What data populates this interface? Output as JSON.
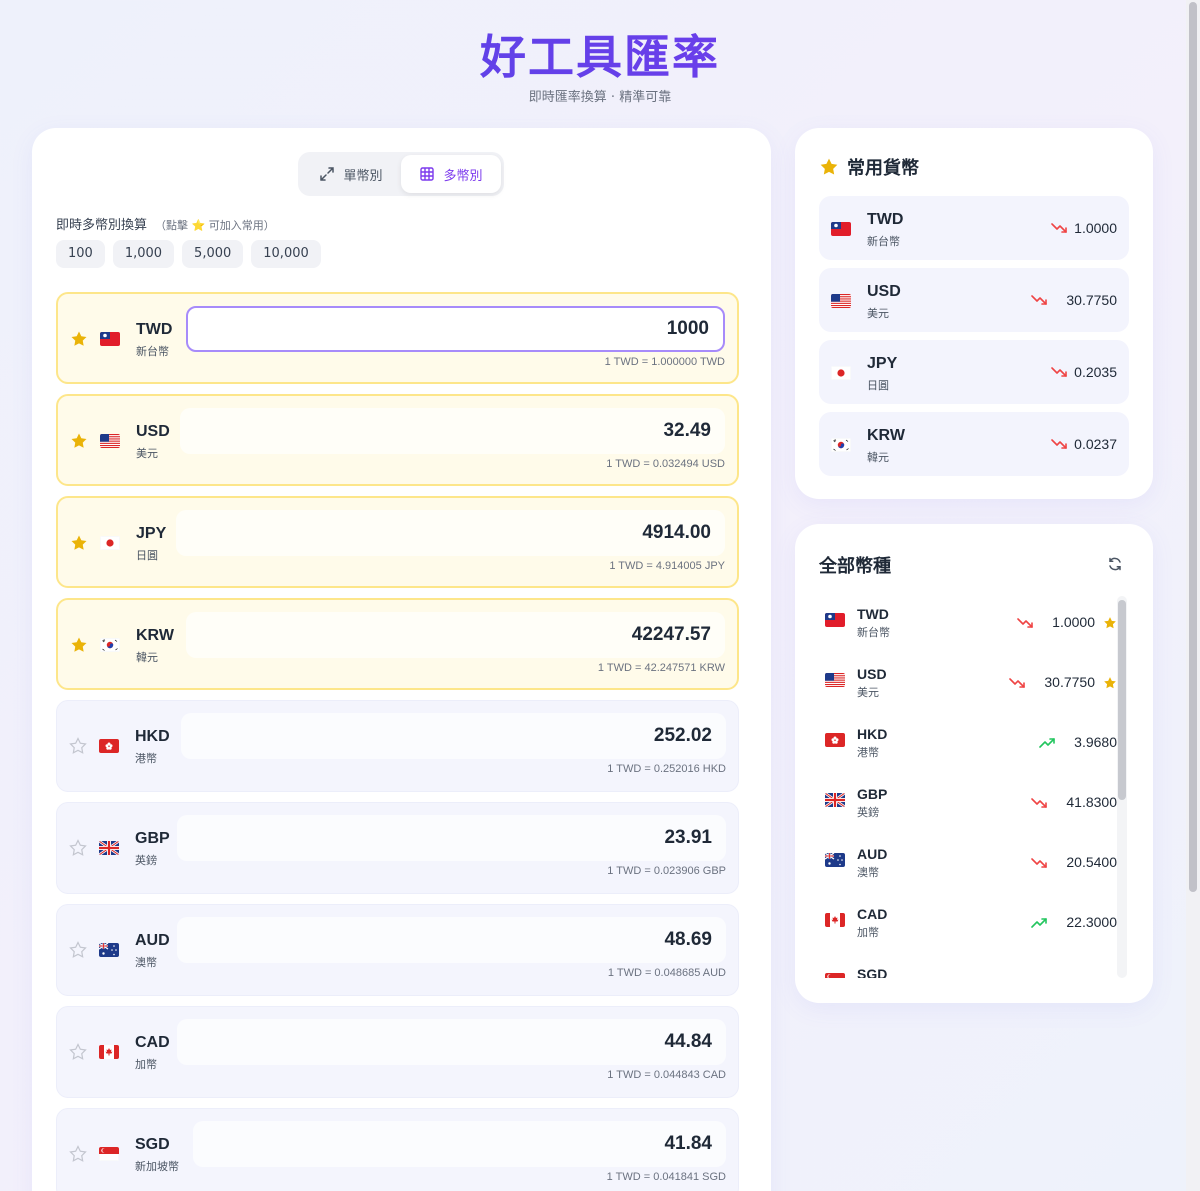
{
  "header": {
    "title": "好工具匯率",
    "subtitle": "即時匯率換算 · 精準可靠"
  },
  "mode": {
    "single_label": "單幣別",
    "multi_label": "多幣別",
    "active": "multi"
  },
  "converter": {
    "hint": "即時多幣別換算",
    "hint_small": "（點擊 ⭐ 可加入常用）",
    "quick_amounts": [
      "100",
      "1,000",
      "5,000",
      "10,000"
    ],
    "rows": [
      {
        "code": "TWD",
        "name": "新台幣",
        "flag": "tw",
        "favorite": true,
        "base": true,
        "amount": "1000",
        "rate_line": "1 TWD = 1.000000 TWD"
      },
      {
        "code": "USD",
        "name": "美元",
        "flag": "us",
        "favorite": true,
        "base": false,
        "amount": "32.49",
        "rate_line": "1 TWD = 0.032494 USD"
      },
      {
        "code": "JPY",
        "name": "日圓",
        "flag": "jp",
        "favorite": true,
        "base": false,
        "amount": "4914.00",
        "rate_line": "1 TWD = 4.914005 JPY"
      },
      {
        "code": "KRW",
        "name": "韓元",
        "flag": "kr",
        "favorite": true,
        "base": false,
        "amount": "42247.57",
        "rate_line": "1 TWD = 42.247571 KRW"
      },
      {
        "code": "HKD",
        "name": "港幣",
        "flag": "hk",
        "favorite": false,
        "base": false,
        "amount": "252.02",
        "rate_line": "1 TWD = 0.252016 HKD"
      },
      {
        "code": "GBP",
        "name": "英鎊",
        "flag": "gb",
        "favorite": false,
        "base": false,
        "amount": "23.91",
        "rate_line": "1 TWD = 0.023906 GBP"
      },
      {
        "code": "AUD",
        "name": "澳幣",
        "flag": "au",
        "favorite": false,
        "base": false,
        "amount": "48.69",
        "rate_line": "1 TWD = 0.048685 AUD"
      },
      {
        "code": "CAD",
        "name": "加幣",
        "flag": "ca",
        "favorite": false,
        "base": false,
        "amount": "44.84",
        "rate_line": "1 TWD = 0.044843 CAD"
      },
      {
        "code": "SGD",
        "name": "新加坡幣",
        "flag": "sg",
        "favorite": false,
        "base": false,
        "amount": "41.84",
        "rate_line": "1 TWD = 0.041841 SGD"
      }
    ]
  },
  "favorites": {
    "title": "常用貨幣",
    "items": [
      {
        "code": "TWD",
        "name": "新台幣",
        "flag": "tw",
        "trend": "down",
        "rate": "1.0000"
      },
      {
        "code": "USD",
        "name": "美元",
        "flag": "us",
        "trend": "down",
        "rate": "30.7750"
      },
      {
        "code": "JPY",
        "name": "日圓",
        "flag": "jp",
        "trend": "down",
        "rate": "0.2035"
      },
      {
        "code": "KRW",
        "name": "韓元",
        "flag": "kr",
        "trend": "down",
        "rate": "0.0237"
      }
    ]
  },
  "all_currencies": {
    "title": "全部幣種",
    "items": [
      {
        "code": "TWD",
        "name": "新台幣",
        "flag": "tw",
        "trend": "down",
        "rate": "1.0000",
        "favorite": true
      },
      {
        "code": "USD",
        "name": "美元",
        "flag": "us",
        "trend": "down",
        "rate": "30.7750",
        "favorite": true
      },
      {
        "code": "HKD",
        "name": "港幣",
        "flag": "hk",
        "trend": "up",
        "rate": "3.9680",
        "favorite": false
      },
      {
        "code": "GBP",
        "name": "英鎊",
        "flag": "gb",
        "trend": "down",
        "rate": "41.8300",
        "favorite": false
      },
      {
        "code": "AUD",
        "name": "澳幣",
        "flag": "au",
        "trend": "down",
        "rate": "20.5400",
        "favorite": false
      },
      {
        "code": "CAD",
        "name": "加幣",
        "flag": "ca",
        "trend": "up",
        "rate": "22.3000",
        "favorite": false
      },
      {
        "code": "SGD",
        "name": "",
        "flag": "sg",
        "trend": "down",
        "rate": "",
        "favorite": false
      }
    ]
  },
  "colors": {
    "accent": "#7c3aed",
    "title_gradient_start": "#4f46e5",
    "favorite_border": "#fde68a",
    "favorite_bg": "#fffbea",
    "star": "#eab308",
    "trend_down": "#ef4444",
    "trend_up": "#22c55e"
  }
}
